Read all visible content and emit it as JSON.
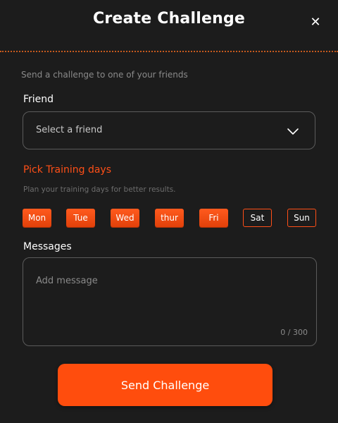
{
  "header": {
    "title": "Create Challenge",
    "close_icon": "close-icon"
  },
  "form": {
    "subtitle": "Send a challenge to one of your friends",
    "friend_label": "Friend",
    "friend_select": {
      "value": "Select a friend",
      "icon": "chevron-down-icon"
    },
    "training_title": "Pick Training days",
    "training_subtitle": "Plan your training days for better results.",
    "days": [
      {
        "label": "Mon",
        "selected": true
      },
      {
        "label": "Tue",
        "selected": true
      },
      {
        "label": "Wed",
        "selected": true
      },
      {
        "label": "thur",
        "selected": true
      },
      {
        "label": "Fri",
        "selected": true
      },
      {
        "label": "Sat",
        "selected": false
      },
      {
        "label": "Sun",
        "selected": false
      }
    ],
    "messages_label": "Messages",
    "message_placeholder": "Add message",
    "message_counter": "0 / 300",
    "send_label": "Send Challenge"
  },
  "colors": {
    "accent": "#ff4f17",
    "background": "#1c1c1c",
    "border": "#5b5b5b",
    "divider": "#c85a1d"
  }
}
